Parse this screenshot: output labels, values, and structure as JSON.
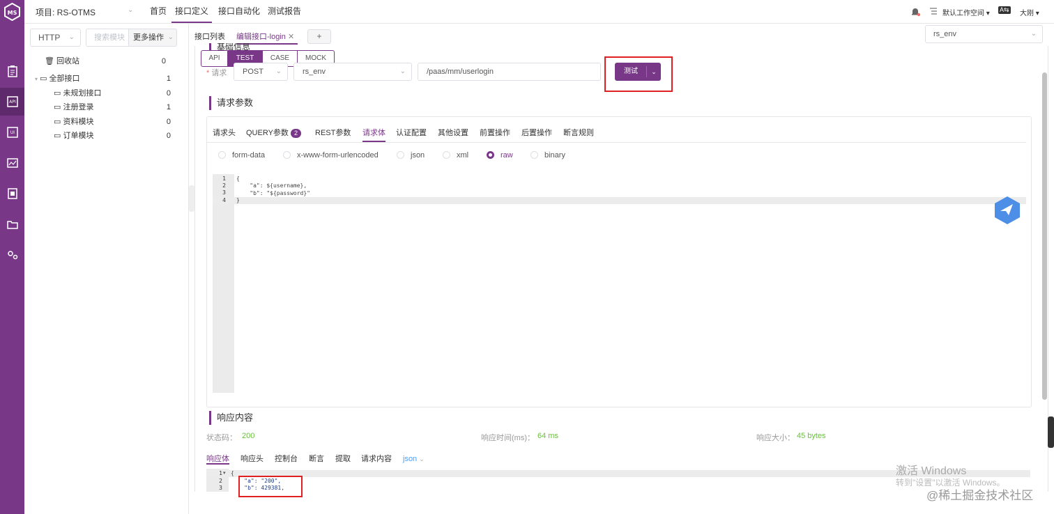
{
  "header": {
    "project_label": "项目: RS-OTMS",
    "nav": [
      "首页",
      "接口定义",
      "接口自动化",
      "测试报告"
    ],
    "active_nav": 1,
    "workspace": "默认工作空间",
    "lang": "A⇆",
    "user": "大刚"
  },
  "rail": {
    "icons": [
      "clipboard-icon",
      "api-icon",
      "ui-icon",
      "performance-icon",
      "report-icon",
      "folder-icon",
      "settings-icon"
    ],
    "active": 1
  },
  "sidebar": {
    "protocol": "HTTP",
    "search_placeholder": "搜索模块",
    "more_ops": "更多操作",
    "recycle": {
      "label": "回收站",
      "count": "0"
    },
    "root": {
      "label": "全部接口",
      "count": "1"
    },
    "children": [
      {
        "label": "未规划接口",
        "count": "0"
      },
      {
        "label": "注册登录",
        "count": "1"
      },
      {
        "label": "资料模块",
        "count": "0"
      },
      {
        "label": "订单模块",
        "count": "0"
      }
    ]
  },
  "tabs": {
    "list": "接口列表",
    "edit": "编辑接口-login",
    "add": "+",
    "env": "rs_env"
  },
  "mode_tabs": [
    "API",
    "TEST",
    "CASE",
    "MOCK"
  ],
  "mode_active": 1,
  "request": {
    "hidden_title": "基础信息",
    "label": "请求",
    "method": "POST",
    "env": "rs_env",
    "url": "/paas/mm/userlogin",
    "test_button": "测试"
  },
  "params": {
    "title": "请求参数",
    "tabs": [
      "请求头",
      "QUERY参数",
      "REST参数",
      "请求体",
      "认证配置",
      "其他设置",
      "前置操作",
      "后置操作",
      "断言规则"
    ],
    "query_badge": "2",
    "active_tab": 3,
    "body_types": [
      "form-data",
      "x-www-form-urlencoded",
      "json",
      "xml",
      "raw",
      "binary"
    ],
    "body_active": 4,
    "code_lines": [
      "{",
      "    \"a\": ${username},",
      "    \"b\": \"${password}\"",
      "}"
    ]
  },
  "response": {
    "title": "响应内容",
    "status_label": "状态码：",
    "status": "200",
    "time_label": "响应时间(ms)：",
    "time": "64 ms",
    "size_label": "响应大小：",
    "size": "45 bytes",
    "tabs": [
      "响应体",
      "响应头",
      "控制台",
      "断言",
      "提取",
      "请求内容"
    ],
    "format": "json",
    "code_lines": [
      "{",
      "    \"a\": \"200\",",
      "    \"b\": 429381,"
    ]
  },
  "watermark": {
    "activate": "激活 Windows",
    "activate_sub": "转到\"设置\"以激活 Windows。",
    "brand": "@稀土掘金技术社区"
  },
  "colors": {
    "primary": "#783887",
    "rail": "#783887",
    "success": "#67c23a",
    "highlight": "#e02020"
  }
}
